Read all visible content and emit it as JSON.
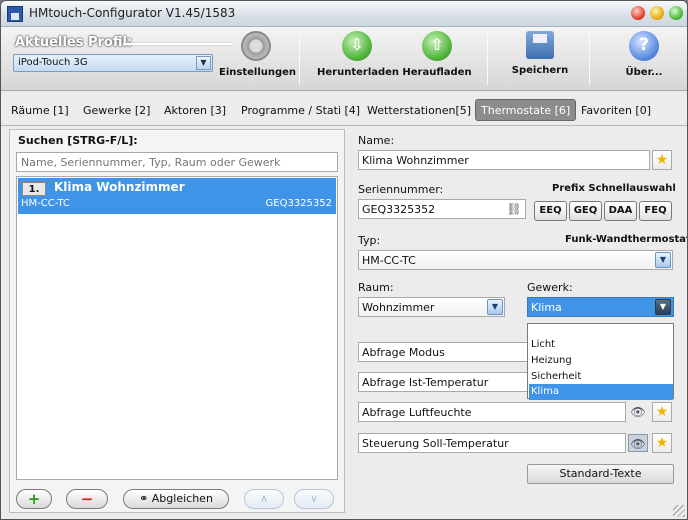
{
  "window": {
    "title": "HMtouch-Configurator V1.45/1583"
  },
  "toolbar": {
    "profile_label": "Aktuelles Profil:",
    "profile_value": "iPod-Touch 3G",
    "buttons": [
      {
        "label": "Einstellungen",
        "icon": "gear-icon"
      },
      {
        "label": "Herunterladen",
        "icon": "download-icon"
      },
      {
        "label": "Heraufladen",
        "icon": "upload-icon"
      },
      {
        "label": "Speichern",
        "icon": "floppy-disk-icon"
      },
      {
        "label": "Über...",
        "icon": "help-icon"
      }
    ]
  },
  "tabs": [
    {
      "label": "Räume [1]"
    },
    {
      "label": "Gewerke [2]"
    },
    {
      "label": "Aktoren [3]"
    },
    {
      "label": "Programme / Stati [4]"
    },
    {
      "label": "Wetterstationen[5]"
    },
    {
      "label": "Thermostate [6]",
      "active": true
    },
    {
      "label": "Favoriten [0]"
    }
  ],
  "left": {
    "search_label": "Suchen [STRG-F/L]:",
    "search_placeholder": "Name, Seriennummer, Typ, Raum oder Gewerk",
    "items": [
      {
        "index": "1.",
        "name": "Klima Wohnzimmer",
        "type": "HM-CC-TC",
        "serial": "GEQ3325352"
      }
    ],
    "buttons": {
      "add": "+",
      "remove": "−",
      "sync": "Abgleichen",
      "up": "∧",
      "down": "∨"
    }
  },
  "right": {
    "name_label": "Name:",
    "name_value": "Klima Wohnzimmer",
    "serial_label": "Seriennummer:",
    "serial_value": "GEQ3325352",
    "prefix_label": "Prefix Schnellauswahl",
    "prefixes": [
      "EEQ",
      "GEQ",
      "DAA",
      "FEQ"
    ],
    "type_label": "Typ:",
    "type_caption": "Funk-Wandthermostat",
    "type_value": "HM-CC-TC",
    "room_label": "Raum:",
    "room_value": "Wohnzimmer",
    "trade_label": "Gewerk:",
    "trade_value": "Klima",
    "trade_options": [
      "",
      "Licht",
      "Heizung",
      "Sicherheit",
      "Klima"
    ],
    "queries": [
      "Abfrage Modus",
      "Abfrage Ist-Temperatur",
      "Abfrage Luftfeuchte",
      "Steuerung Soll-Temperatur"
    ],
    "standard_texts_button": "Standard-Texte"
  }
}
